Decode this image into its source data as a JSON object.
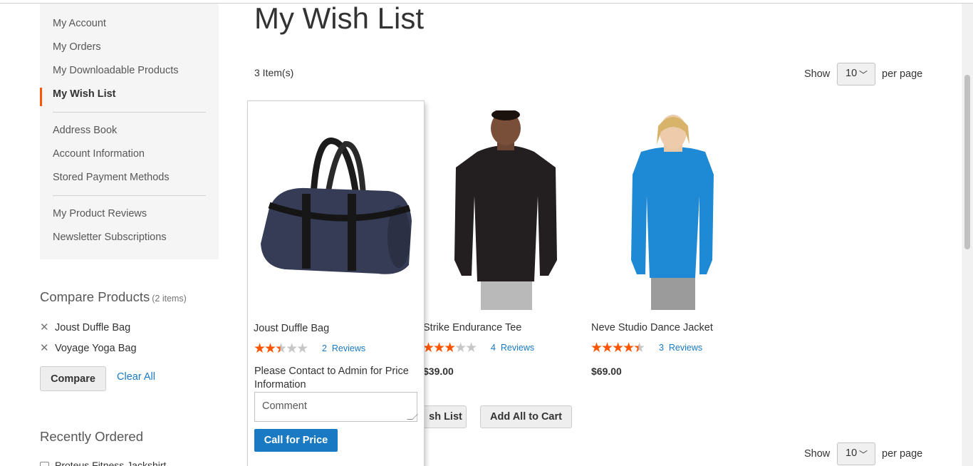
{
  "sidebar": {
    "nav_items": [
      {
        "label": "My Account"
      },
      {
        "label": "My Orders"
      },
      {
        "label": "My Downloadable Products"
      },
      {
        "label": "My Wish List",
        "current": true
      },
      {
        "label": "Address Book"
      },
      {
        "label": "Account Information"
      },
      {
        "label": "Stored Payment Methods"
      },
      {
        "label": "My Product Reviews"
      },
      {
        "label": "Newsletter Subscriptions"
      }
    ],
    "compare": {
      "title": "Compare Products",
      "count": "(2 items)",
      "items": [
        "Joust Duffle Bag",
        "Voyage Yoga Bag"
      ],
      "compare_button": "Compare",
      "clear_all": "Clear All"
    },
    "recently_ordered": {
      "title": "Recently Ordered",
      "items": [
        "Proteus Fitness Jackshirt"
      ]
    }
  },
  "main": {
    "title": "My Wish List",
    "items_count": "3 Item(s)",
    "toolbar": {
      "show_label": "Show",
      "per_page_value": "10",
      "per_page_label": "per page"
    },
    "products": [
      {
        "name": "Joust Duffle Bag",
        "rating": 2.5,
        "reviews_count": "2",
        "reviews_label": "Reviews",
        "contact_text": "Please Contact to Admin for Price Information",
        "comment_placeholder": "Comment",
        "call_button": "Call for Price"
      },
      {
        "name": "Strike Endurance Tee",
        "rating": 3,
        "reviews_count": "4",
        "reviews_label": "Reviews",
        "price": "$39.00"
      },
      {
        "name": "Neve Studio Dance Jacket",
        "rating": 4.5,
        "reviews_count": "3",
        "reviews_label": "Reviews",
        "price": "$69.00"
      }
    ],
    "actions": {
      "update_wishlist_partial": "sh List",
      "add_all_to_cart": "Add All to Cart"
    },
    "colors": {
      "accent": "#ff5501",
      "link": "#1979c3",
      "primary_button": "#1979c3"
    }
  }
}
